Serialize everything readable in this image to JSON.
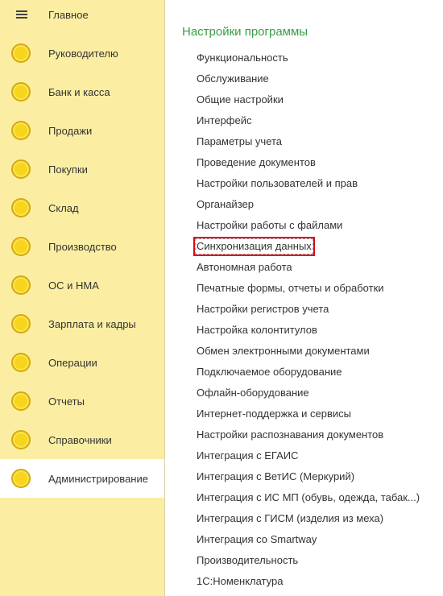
{
  "sidebar": {
    "items": [
      {
        "label": "Главное",
        "icon": "menu-icon"
      },
      {
        "label": "Руководителю",
        "icon": "coin-icon"
      },
      {
        "label": "Банк и касса",
        "icon": "coin-icon"
      },
      {
        "label": "Продажи",
        "icon": "coin-icon"
      },
      {
        "label": "Покупки",
        "icon": "coin-icon"
      },
      {
        "label": "Склад",
        "icon": "coin-icon"
      },
      {
        "label": "Производство",
        "icon": "coin-icon"
      },
      {
        "label": "ОС и НМА",
        "icon": "coin-icon"
      },
      {
        "label": "Зарплата и кадры",
        "icon": "coin-icon"
      },
      {
        "label": "Операции",
        "icon": "coin-icon"
      },
      {
        "label": "Отчеты",
        "icon": "coin-icon"
      },
      {
        "label": "Справочники",
        "icon": "coin-icon"
      },
      {
        "label": "Администрирование",
        "icon": "coin-icon",
        "active": true
      }
    ]
  },
  "main": {
    "title": "Настройки программы",
    "links": [
      "Функциональность",
      "Обслуживание",
      "Общие настройки",
      "Интерфейс",
      "Параметры учета",
      "Проведение документов",
      "Настройки пользователей и прав",
      "Органайзер",
      "Настройки работы с файлами",
      "Синхронизация данных",
      "Автономная работа",
      "Печатные формы, отчеты и обработки",
      "Настройки регистров учета",
      "Настройка колонтитулов",
      "Обмен электронными документами",
      "Подключаемое оборудование",
      "Офлайн-оборудование",
      "Интернет-поддержка и сервисы",
      "Настройки распознавания документов",
      "Интеграция с ЕГАИС",
      "Интеграция с ВетИС (Меркурий)",
      "Интеграция с ИС МП (обувь, одежда, табак...)",
      "Интеграция с ГИСМ (изделия из меха)",
      "Интеграция со Smartway",
      "Производительность",
      "1С:Номенклатура"
    ],
    "highlighted_link": "Синхронизация данных"
  },
  "colors": {
    "sidebar_bg": "#fbeea3",
    "title_green": "#3a9d44",
    "highlight_red": "#e30613",
    "coin_yellow": "#f7d51d"
  }
}
